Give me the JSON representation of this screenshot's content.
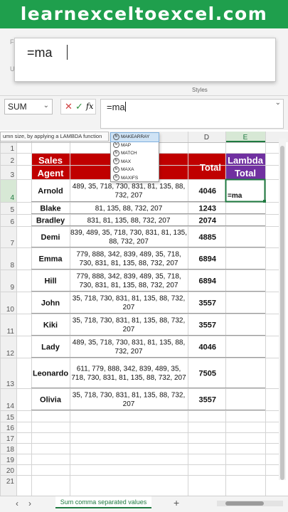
{
  "banner": "learnexceltoexcel.com",
  "zoom_text": "=ma",
  "ribbon": {
    "ghost_labels": [
      "F",
      "U"
    ],
    "styles_label": "Styles"
  },
  "formula_bar": {
    "name_box": "SUM",
    "fx": "fx",
    "cancel": "✕",
    "confirm": "✓",
    "formula": "=ma"
  },
  "tooltip": "umn size, by applying a LAMBDA function",
  "autocomplete": [
    "MAKEARRAY",
    "MAP",
    "MATCH",
    "MAX",
    "MAXA",
    "MAXIFS"
  ],
  "columns": [
    "D",
    "E"
  ],
  "headers": {
    "agent": "Sales Agent",
    "total": "Total",
    "lambda": "Lambda Total"
  },
  "edit_cell": "=ma",
  "colors": {
    "header_red": "#c00000",
    "header_purple": "#7030a0",
    "banner_green": "#1f9f4d",
    "accent_green": "#1f7a40"
  },
  "rows": [
    {
      "n": "4",
      "name": "Arnold",
      "values": "489, 35, 718, 730, 831, 81, 135, 88, 732, 207",
      "total": "4046"
    },
    {
      "n": "5",
      "name": "Blake",
      "values": "81, 135, 88, 732, 207",
      "total": "1243"
    },
    {
      "n": "6",
      "name": "Bradley",
      "values": "831, 81, 135, 88, 732, 207",
      "total": "2074"
    },
    {
      "n": "7",
      "name": "Demi",
      "values": "839, 489, 35, 718, 730, 831, 81, 135, 88, 732, 207",
      "total": "4885"
    },
    {
      "n": "8",
      "name": "Emma",
      "values": "779, 888, 342, 839, 489, 35, 718, 730, 831, 81, 135, 88, 732, 207",
      "total": "6894"
    },
    {
      "n": "9",
      "name": "Hill",
      "values": "779, 888, 342, 839, 489, 35, 718, 730, 831, 81, 135, 88, 732, 207",
      "total": "6894"
    },
    {
      "n": "10",
      "name": "John",
      "values": "35, 718, 730, 831, 81, 135, 88, 732, 207",
      "total": "3557"
    },
    {
      "n": "11",
      "name": "Kiki",
      "values": "35, 718, 730, 831, 81, 135, 88, 732, 207",
      "total": "3557"
    },
    {
      "n": "12",
      "name": "Lady",
      "values": "489, 35, 718, 730, 831, 81, 135, 88, 732, 207",
      "total": "4046"
    },
    {
      "n": "13",
      "name": "Leonardo",
      "values": "611, 779, 888, 342, 839, 489, 35, 718, 730, 831, 81, 135, 88, 732, 207",
      "total": "7505"
    },
    {
      "n": "14",
      "name": "Olivia",
      "values": "35, 718, 730, 831, 81, 135, 88, 732, 207",
      "total": "3557"
    }
  ],
  "empty_rows": [
    "1",
    "15",
    "16",
    "17",
    "18",
    "19",
    "20",
    "21"
  ],
  "sheet_tab": "Sum comma separated values",
  "sheet_nav": {
    "prev": "‹",
    "next": "›",
    "add": "+"
  }
}
